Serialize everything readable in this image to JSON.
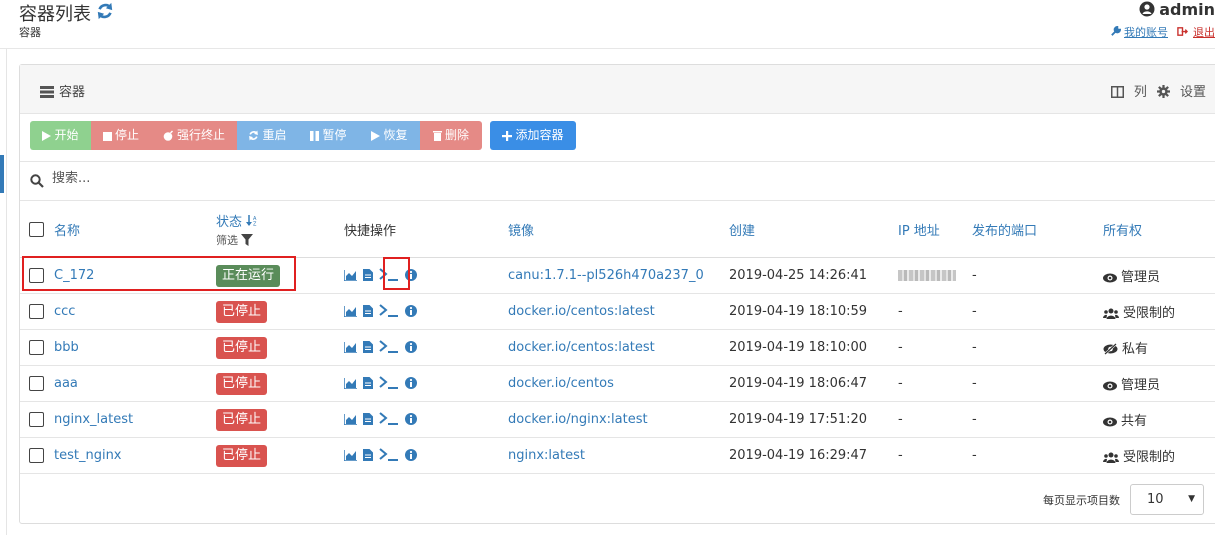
{
  "header": {
    "title": "容器列表",
    "subtitle": "容器",
    "user": "admin",
    "my_account": "我的账号",
    "logout": "退出"
  },
  "widget": {
    "title": "容器",
    "columns_label": "列",
    "settings_label": "设置"
  },
  "toolbar": {
    "start": "开始",
    "stop": "停止",
    "kill": "强行终止",
    "restart": "重启",
    "pause": "暂停",
    "resume": "恢复",
    "remove": "删除",
    "add": "添加容器"
  },
  "search": {
    "placeholder": "搜索..."
  },
  "table": {
    "headers": {
      "name": "名称",
      "state": "状态",
      "filter": "筛选",
      "quick_actions": "快捷操作",
      "image": "镜像",
      "created": "创建",
      "ip": "IP 地址",
      "ports": "发布的端口",
      "ownership": "所有权"
    },
    "rows": [
      {
        "name": "C_172",
        "state": "正在运行",
        "image": "canu:1.7.1--pl526h470a237_0",
        "created": "2019-04-25 14:26:41",
        "ip": "",
        "ports": "-",
        "ownership": "管理员"
      },
      {
        "name": "ccc",
        "state": "已停止",
        "image": "docker.io/centos:latest",
        "created": "2019-04-19 18:10:59",
        "ip": "-",
        "ports": "-",
        "ownership": "受限制的"
      },
      {
        "name": "bbb",
        "state": "已停止",
        "image": "docker.io/centos:latest",
        "created": "2019-04-19 18:10:00",
        "ip": "-",
        "ports": "-",
        "ownership": "私有"
      },
      {
        "name": "aaa",
        "state": "已停止",
        "image": "docker.io/centos",
        "created": "2019-04-19 18:06:47",
        "ip": "-",
        "ports": "-",
        "ownership": "管理员"
      },
      {
        "name": "nginx_latest",
        "state": "已停止",
        "image": "docker.io/nginx:latest",
        "created": "2019-04-19 17:51:20",
        "ip": "-",
        "ports": "-",
        "ownership": "共有"
      },
      {
        "name": "test_nginx",
        "state": "已停止",
        "image": "nginx:latest",
        "created": "2019-04-19 16:29:47",
        "ip": "-",
        "ports": "-",
        "ownership": "受限制的"
      }
    ]
  },
  "pagination": {
    "label": "每页显示项目数",
    "value": "10"
  },
  "colors": {
    "accent": "#337ab7",
    "running": "#5a8c5a",
    "stopped": "#d9534f"
  }
}
